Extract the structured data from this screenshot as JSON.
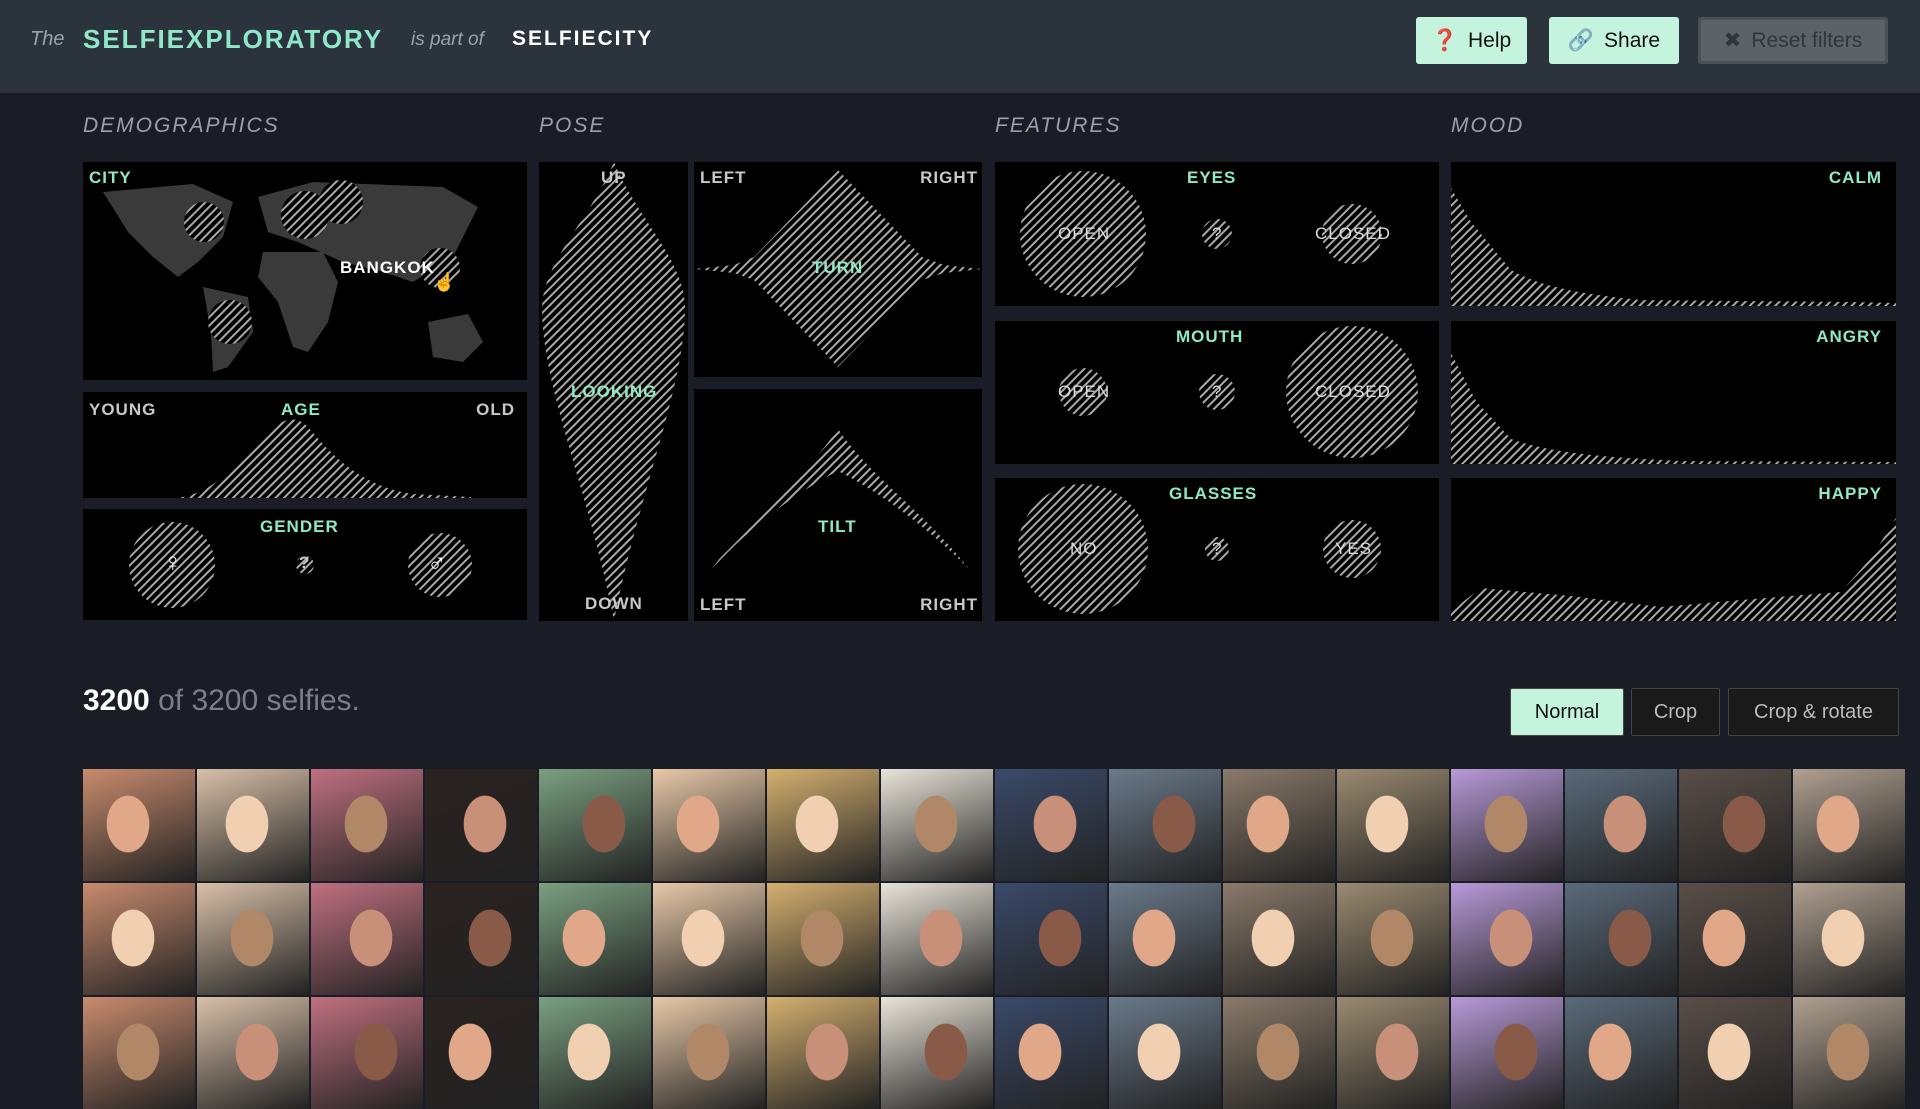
{
  "header": {
    "prefix": "The",
    "title": "SELFIEXPLORATORY",
    "connector": "is part of",
    "parent": "SELFIECITY",
    "buttons": {
      "help": "Help",
      "share": "Share",
      "reset": "Reset filters"
    }
  },
  "sections": {
    "demographics": "DEMOGRAPHICS",
    "pose": "POSE",
    "features": "FEATURES",
    "mood": "MOOD"
  },
  "demographics": {
    "city": {
      "label": "CITY",
      "hovered": "BANGKOK"
    },
    "age": {
      "label": "AGE",
      "min": "YOUNG",
      "max": "OLD"
    },
    "gender": {
      "label": "GENDER",
      "female": "♀",
      "unknown": "?",
      "male": "♂"
    }
  },
  "pose": {
    "looking": {
      "label": "LOOKING",
      "top": "UP",
      "bottom": "DOWN"
    },
    "turn": {
      "label": "TURN",
      "left": "LEFT",
      "right": "RIGHT"
    },
    "tilt": {
      "label": "TILT",
      "left": "LEFT",
      "right": "RIGHT"
    }
  },
  "features": {
    "eyes": {
      "label": "EYES",
      "a": "OPEN",
      "u": "?",
      "b": "CLOSED"
    },
    "mouth": {
      "label": "MOUTH",
      "a": "OPEN",
      "u": "?",
      "b": "CLOSED"
    },
    "glasses": {
      "label": "GLASSES",
      "a": "NO",
      "u": "?",
      "b": "YES"
    }
  },
  "mood": {
    "calm": "CALM",
    "angry": "ANGRY",
    "happy": "HAPPY"
  },
  "results": {
    "shown": "3200",
    "rest": " of 3200 selfies."
  },
  "view_modes": {
    "normal": "Normal",
    "crop": "Crop",
    "crop_rotate": "Crop & rotate",
    "active": "Normal"
  },
  "colors": {
    "accent": "#8fe8c8",
    "button": "#c4f3de",
    "header": "#2b343d",
    "background": "#1a1d25"
  }
}
